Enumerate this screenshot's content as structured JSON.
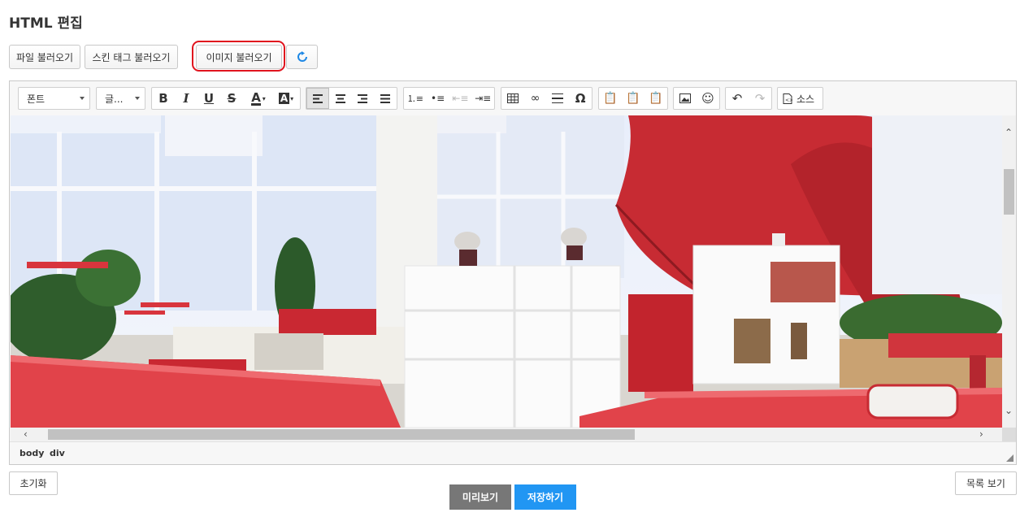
{
  "page": {
    "title": "HTML 편집"
  },
  "top_buttons": {
    "load_file": "파일 불러오기",
    "load_skin_tag": "스킨 태그 불러오기",
    "load_image": "이미지 불러오기",
    "refresh_icon": "refresh-icon"
  },
  "toolbar": {
    "font_combo": "폰트",
    "size_combo": "글...",
    "source_label": "소스",
    "icons": [
      "bold",
      "italic",
      "underline",
      "strikethrough",
      "text-color",
      "bg-color",
      "align-left",
      "align-center",
      "align-right",
      "justify",
      "numbered-list",
      "bulleted-list",
      "outdent",
      "indent",
      "table",
      "link",
      "horizontal-rule",
      "special-char",
      "paste",
      "paste-text",
      "paste-word",
      "image",
      "emoticon",
      "undo",
      "redo",
      "source"
    ]
  },
  "statusbar": {
    "path": [
      "body",
      "div"
    ]
  },
  "bottom_buttons": {
    "reset": "초기화",
    "preview": "미리보기",
    "save": "저장하기",
    "list": "목록 보기"
  },
  "colors": {
    "accent_blue": "#2196f3",
    "preview_gray": "#777777",
    "highlight_red": "#e0141e"
  }
}
